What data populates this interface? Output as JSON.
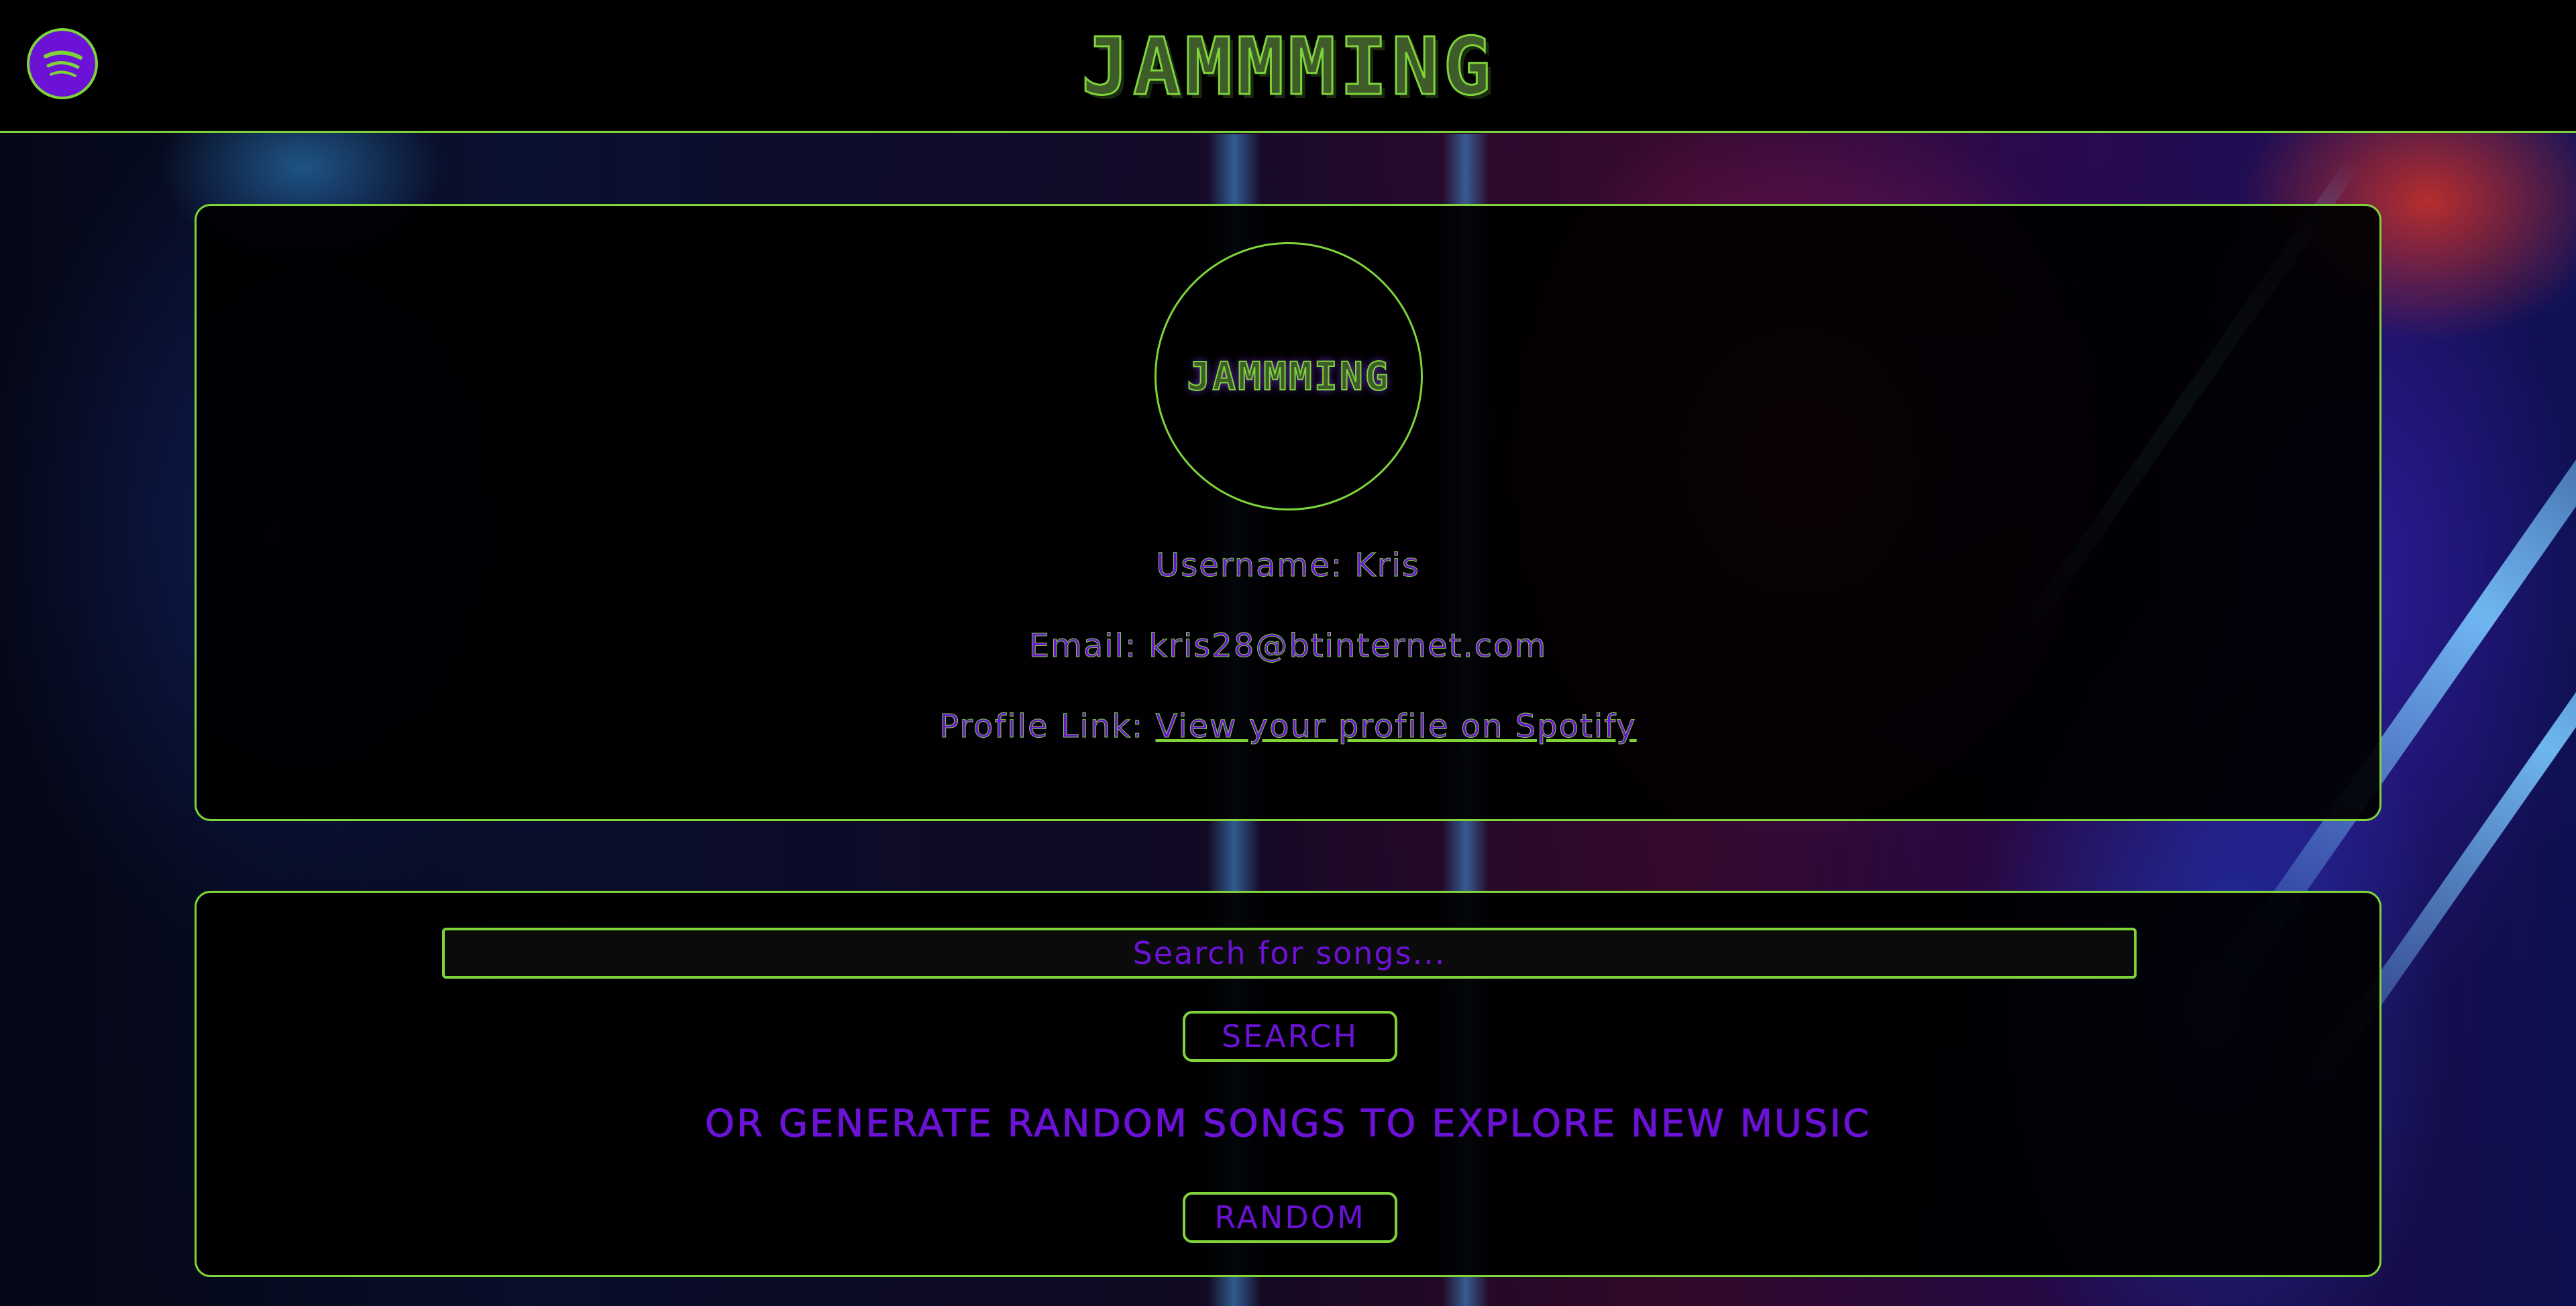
{
  "header": {
    "title": "JAMMMING",
    "spotify_icon": "spotify-icon"
  },
  "profile": {
    "avatar_text": "JAMMMING",
    "username_label": "Username:",
    "username_value": "Kris",
    "email_label": "Email:",
    "email_value": "kris28@btinternet.com",
    "profile_link_label": "Profile Link:",
    "profile_link_text": "View your profile on Spotify"
  },
  "search": {
    "placeholder": "Search for songs...",
    "search_button_label": "SEARCH",
    "explore_text": "OR GENERATE RANDOM SONGS TO EXPLORE NEW MUSIC",
    "random_button_label": "RANDOM"
  },
  "colors": {
    "accent_green": "#7fd43a",
    "accent_purple": "#6b12d6",
    "panel_bg": "#000000"
  }
}
